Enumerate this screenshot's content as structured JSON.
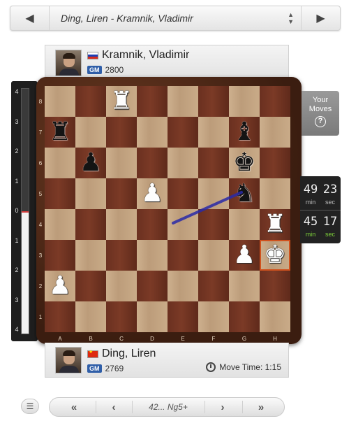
{
  "game_selector": {
    "title": "Ding, Liren - Kramnik, Vladimir",
    "prev_icon": "triangle-left-icon",
    "next_icon": "triangle-right-icon",
    "updown_icon": "updown-arrows-icon"
  },
  "top_player": {
    "name": "Kramnik, Vladimir",
    "country": "RU",
    "title_badge": "GM",
    "rating": "2800"
  },
  "bottom_player": {
    "name": "Ding, Liren",
    "country": "CN",
    "title_badge": "GM",
    "rating": "2769",
    "move_time_label": "Move Time: 1:15"
  },
  "eval_bar": {
    "ticks": [
      "4",
      "3",
      "2",
      "1",
      "0",
      "1",
      "2",
      "3",
      "4"
    ],
    "evaluation": 0.0
  },
  "your_moves": {
    "line1": "Your",
    "line2": "Moves",
    "icon": "question-icon"
  },
  "clocks": [
    {
      "minutes": "49",
      "seconds": "23",
      "min_label": "min",
      "sec_label": "sec",
      "active": false
    },
    {
      "minutes": "45",
      "seconds": "17",
      "min_label": "min",
      "sec_label": "sec",
      "active": true
    }
  ],
  "board": {
    "files": [
      "A",
      "B",
      "C",
      "D",
      "E",
      "F",
      "G",
      "H"
    ],
    "ranks": [
      "8",
      "7",
      "6",
      "5",
      "4",
      "3",
      "2",
      "1"
    ],
    "pieces": [
      {
        "square": "c8",
        "piece": "rook",
        "color": "white",
        "glyph": "♜"
      },
      {
        "square": "a7",
        "piece": "rook",
        "color": "black",
        "glyph": "♜"
      },
      {
        "square": "g7",
        "piece": "bishop",
        "color": "black",
        "glyph": "♝"
      },
      {
        "square": "b6",
        "piece": "pawn",
        "color": "black",
        "glyph": "♟"
      },
      {
        "square": "g6",
        "piece": "king",
        "color": "black",
        "glyph": "♚"
      },
      {
        "square": "d5",
        "piece": "pawn",
        "color": "white",
        "glyph": "♟"
      },
      {
        "square": "g5",
        "piece": "knight",
        "color": "black",
        "glyph": "♞"
      },
      {
        "square": "h4",
        "piece": "rook",
        "color": "white",
        "glyph": "♜"
      },
      {
        "square": "g3",
        "piece": "pawn",
        "color": "white",
        "glyph": "♟"
      },
      {
        "square": "h3",
        "piece": "king",
        "color": "white",
        "glyph": "♚"
      },
      {
        "square": "a2",
        "piece": "pawn",
        "color": "white",
        "glyph": "♟"
      }
    ],
    "highlight_square": "h3",
    "arrow": {
      "from": "e4",
      "to": "g5",
      "color": "#2a2aa8"
    }
  },
  "navigation": {
    "menu_icon": "hamburger-icon",
    "first_icon": "double-chevron-left-icon",
    "prev_icon": "chevron-left-icon",
    "current_move": "42... Ng5+",
    "next_icon": "chevron-right-icon",
    "last_icon": "double-chevron-right-icon"
  }
}
